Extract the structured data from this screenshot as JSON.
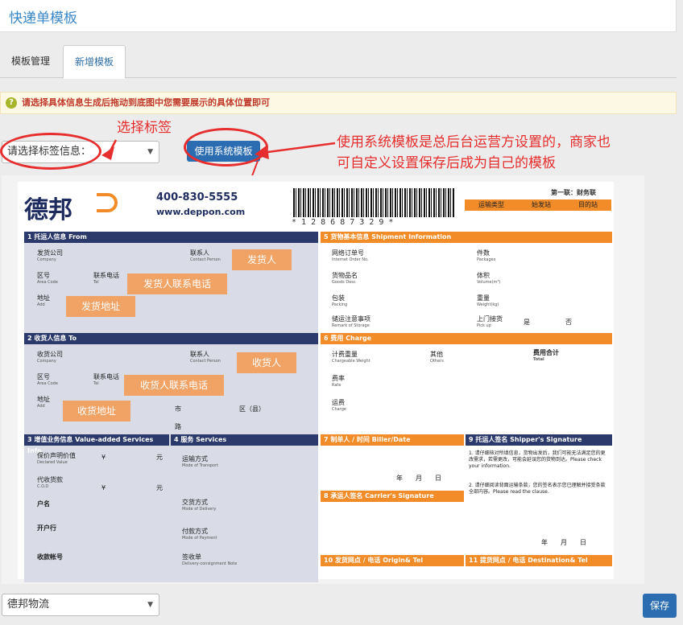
{
  "page": {
    "title": "快递单模板"
  },
  "tabs": [
    {
      "label": "模板管理"
    },
    {
      "label": "新增模板"
    }
  ],
  "tip": "请选择具体信息生成后拖动到底图中您需要展示的具体位置即可",
  "label_select": {
    "value": "请选择标签信息："
  },
  "system_button": "使用系统模板",
  "annotations": {
    "select_label": "选择标签",
    "note_line1": "使用系统模板是总后台运营方设置的，商家也",
    "note_line2": "可自定义设置保存后成为自己的模板"
  },
  "waybill": {
    "logo": "德邦",
    "phone": "400-830-5555",
    "site": "www.deppon.com",
    "barcode": "* 1 2 8 6 8 7 3 2 9 *",
    "copy": "第一联：财务联",
    "top_cols": [
      "运输类型",
      "始发站",
      "目的站"
    ],
    "s1": "1 托运人信息 From",
    "s2": "2 收货人信息 To",
    "s3": "3 增值业务信息 Value-added Services Info",
    "s4": "4 服务 Services",
    "s5": "5 货物基本信息 Shipment Information",
    "s6": "6 费用 Charge",
    "s7": "7 制单人 / 时间 Biller/Date",
    "s8": "8 承运人签名 Carrier's Signature",
    "s9": "9 托运人签名 Shipper's Signature",
    "s10": "10 发货网点 / 电话 Origin& Tel",
    "s11": "11 提货网点 / 电话 Destination& Tel",
    "f_company": "发货公司",
    "f_company_en": "Company",
    "f_contact": "联系人",
    "f_contact_en": "Contact Person",
    "f_area": "区号",
    "f_area_en": "Area Code",
    "f_tel": "联系电话",
    "f_tel_en": "Tel",
    "f_addr": "地址",
    "f_addr_en": "Add",
    "t_company": "收货公司",
    "t_company_en": "Company",
    "t_area": "区号",
    "t_area_en": "Area Code",
    "t_tel": "联系电话",
    "t_tel_en": "Tel",
    "t_addr": "地址",
    "t_addr_en": "Add",
    "t_city": "市",
    "t_district": "区（县）",
    "t_road": "路",
    "s5_order": "网络订单号",
    "s5_order_en": "Internet Order No.",
    "s5_goods": "货物品名",
    "s5_goods_en": "Goods Desc",
    "s5_pack": "包装",
    "s5_pack_en": "Packing",
    "s5_remark": "储运注意事项",
    "s5_remark_en": "Remark of Storage",
    "s5_pieces": "件数",
    "s5_pieces_en": "Packages",
    "s5_volume": "体积",
    "s5_volume_en": "Volume(m³)",
    "s5_weight": "重量",
    "s5_weight_en": "Weight(kg)",
    "s5_pickup": "上门接货",
    "s5_pickup_en": "Pick up",
    "s5_yes": "是",
    "s5_no": "否",
    "c_weight": "计费重量",
    "c_weight_en": "Chargeable Weight",
    "c_other": "其他",
    "c_other_en": "Others",
    "c_total": "费用合计",
    "c_total_en": "Total",
    "c_rate": "费率",
    "c_rate_en": "Rate",
    "c_charge": "运费",
    "c_charge_en": "Charge",
    "v_declared": "保价声明价值",
    "v_declared_en": "Declared Value",
    "v_cod": "代收货款",
    "v_cod_en": "C.O.D",
    "v_account": "户名",
    "v_bank": "开户行",
    "v_accno": "收款帐号",
    "v_currency": "¥",
    "v_unit": "元",
    "sv_transport": "运输方式",
    "sv_transport_en": "Mode of Transport",
    "sv_delivery": "交货方式",
    "sv_delivery_en": "Mode of Delivery",
    "sv_payment": "付款方式",
    "sv_payment_en": "Mode of Payment",
    "sv_sign": "签收单",
    "sv_sign_en": "Delivery-consignment Note",
    "ymd": "年　　月　　日",
    "s9_text": "1. 请仔细核对所填信息，货物出发后，我们可能无法满足您的更改需求，若需更改，可能会延误您的货物到达。Please check your information.",
    "s9_text2": "2. 请仔细阅读背面运输条款，您的签名表示您已理解并接受条款全部内容。Please read the clause."
  },
  "tags": [
    {
      "label": "发货人"
    },
    {
      "label": "发货人联系电话"
    },
    {
      "label": "发货地址"
    },
    {
      "label": "收货人"
    },
    {
      "label": "收货人联系电话"
    },
    {
      "label": "收货地址"
    }
  ],
  "template_select": {
    "value": "德邦物流"
  },
  "save_button": "保存",
  "colors": {
    "navy": "#2c3a6b",
    "orange": "#f28c28",
    "tag": "#f2a15e",
    "annotation": "#e62e2e",
    "primary": "#2c6db2"
  }
}
